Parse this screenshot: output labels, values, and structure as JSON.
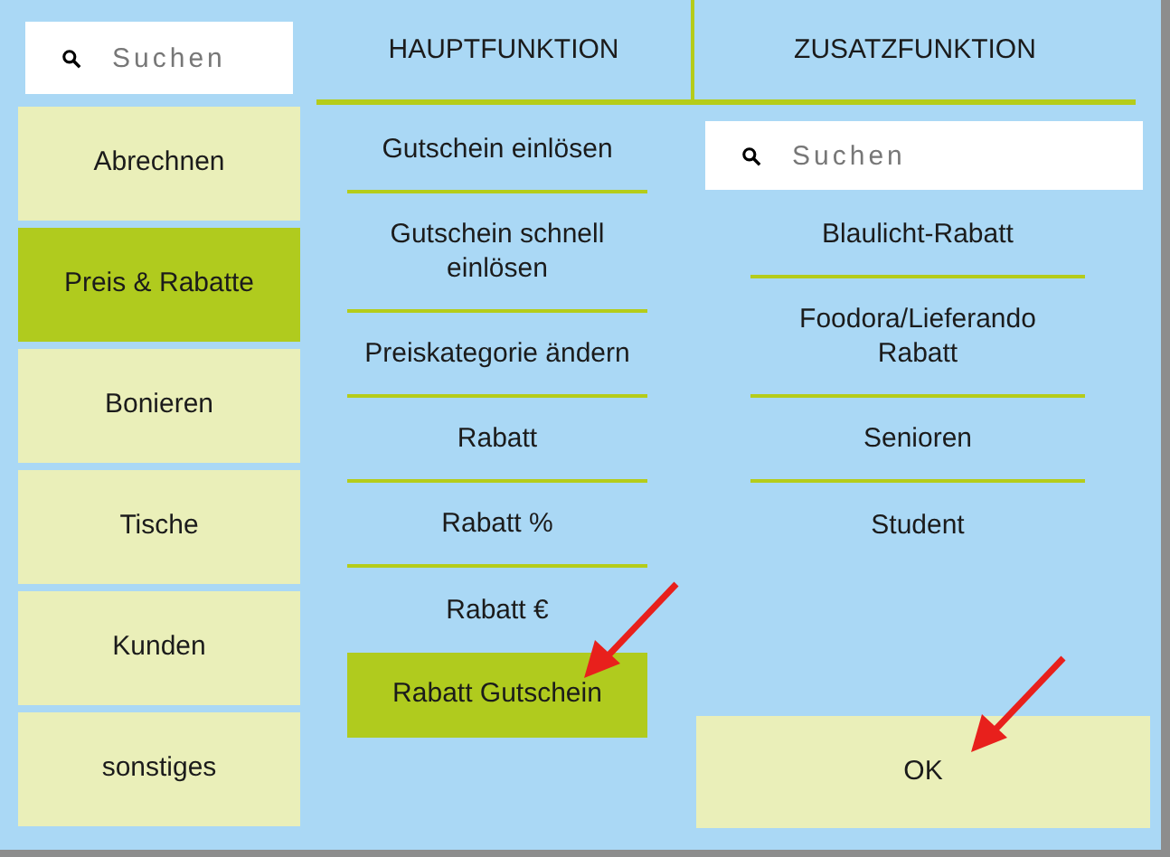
{
  "sidebar": {
    "search": {
      "placeholder": "Suchen"
    },
    "items": [
      {
        "label": "Abrechnen",
        "selected": false
      },
      {
        "label": "Preis & Rabatte",
        "selected": true
      },
      {
        "label": "Bonieren",
        "selected": false
      },
      {
        "label": "Tische",
        "selected": false
      },
      {
        "label": "Kunden",
        "selected": false
      },
      {
        "label": "sonstiges",
        "selected": false
      }
    ]
  },
  "tabs": [
    {
      "label": "HAUPTFUNKTION"
    },
    {
      "label": "ZUSATZFUNKTION"
    }
  ],
  "main_functions": [
    {
      "label": "Gutschein einlösen",
      "selected": false
    },
    {
      "label": "Gutschein schnell einlösen",
      "selected": false
    },
    {
      "label": "Preiskategorie ändern",
      "selected": false
    },
    {
      "label": "Rabatt",
      "selected": false
    },
    {
      "label": "Rabatt %",
      "selected": false
    },
    {
      "label": "Rabatt €",
      "selected": false
    },
    {
      "label": "Rabatt Gutschein",
      "selected": true
    }
  ],
  "extra_functions": {
    "search": {
      "placeholder": "Suchen"
    },
    "items": [
      {
        "label": "Blaulicht-Rabatt"
      },
      {
        "label": "Foodora/Lieferando Rabatt"
      },
      {
        "label": "Senioren"
      },
      {
        "label": "Student"
      }
    ]
  },
  "ok_button": "OK",
  "annotations": [
    {
      "kind": "arrow"
    },
    {
      "kind": "arrow"
    }
  ]
}
